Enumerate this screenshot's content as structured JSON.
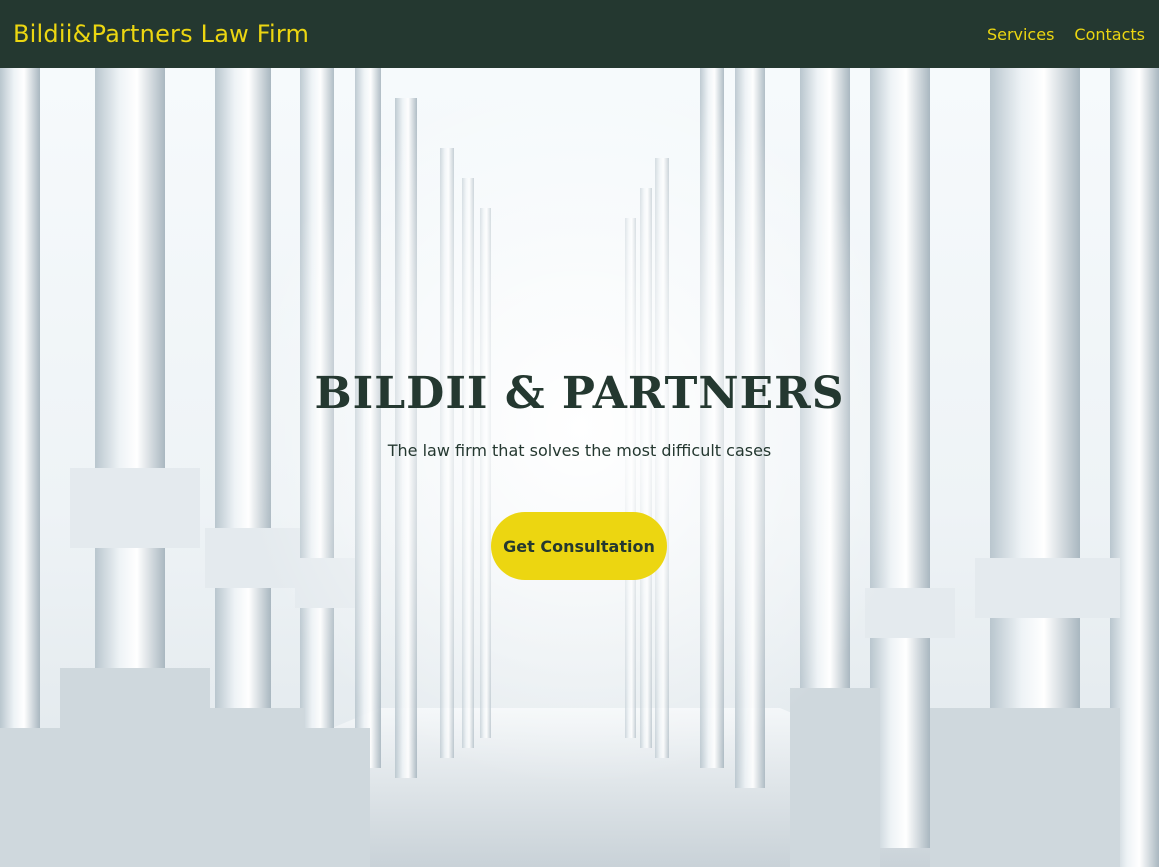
{
  "nav": {
    "brand": "Bildii&Partners Law Firm",
    "links": [
      "Services",
      "Contacts"
    ]
  },
  "hero": {
    "title": "BILDII & PARTNERS",
    "subtitle": "The law firm that solves the most difficult cases",
    "cta_label": "Get Consultation",
    "background_image": "white-columns-photo"
  },
  "colors": {
    "navbar": "#243830",
    "accent": "#ecd611",
    "text_dark": "#243830"
  }
}
